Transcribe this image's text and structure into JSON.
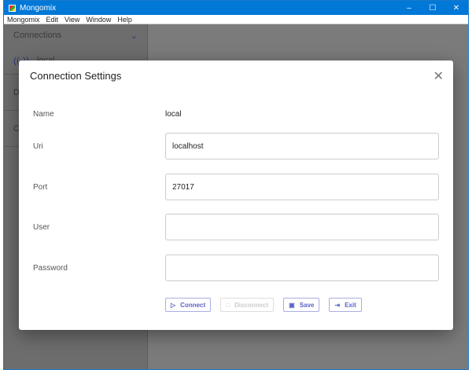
{
  "window": {
    "title": "Mongomix",
    "minimize": "–",
    "maximize": "☐",
    "close": "✕"
  },
  "menu": [
    "Mongomix",
    "Edit",
    "View",
    "Window",
    "Help"
  ],
  "sidebar": {
    "header": "Connections",
    "chevron": "⌄",
    "items": [
      {
        "label": "local",
        "icon": "antenna-icon"
      }
    ],
    "sections": [
      "Da",
      "Co"
    ]
  },
  "dialog": {
    "title": "Connection Settings",
    "close": "✕",
    "fields": {
      "name_label": "Name",
      "name_value": "local",
      "uri_label": "Uri",
      "uri_value": "localhost",
      "port_label": "Port",
      "port_value": "27017",
      "user_label": "User",
      "user_value": "",
      "password_label": "Password",
      "password_value": ""
    },
    "buttons": {
      "connect": "Connect",
      "disconnect": "Disconnect",
      "save": "Save",
      "exit": "Exit"
    }
  },
  "colors": {
    "titlebar": "#0078d7",
    "accent": "#5a63c7"
  }
}
